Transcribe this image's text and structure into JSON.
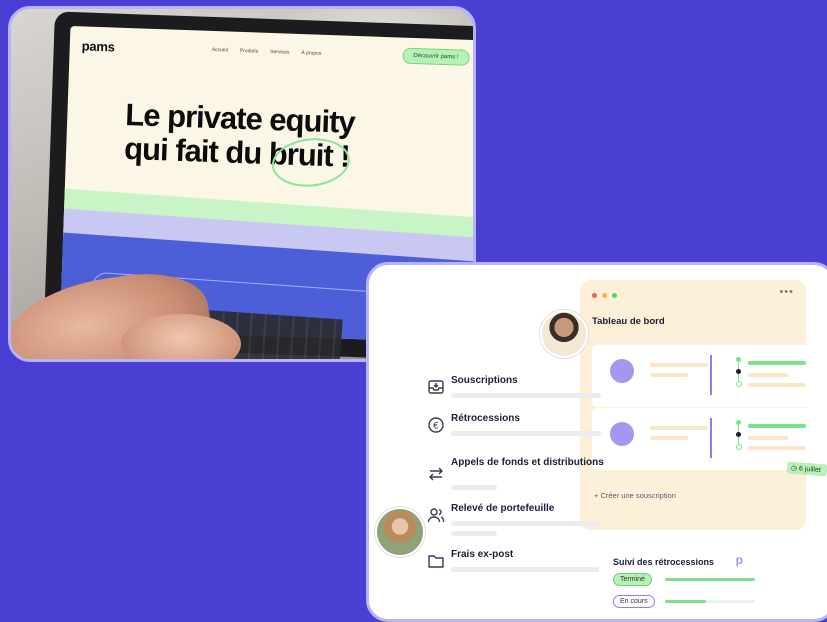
{
  "website": {
    "logo": "pams",
    "nav_links": [
      "Accueil",
      "Produits",
      "Services",
      "À propos"
    ],
    "cta": "Découvrir pams !",
    "hero_line1": "Le private equity",
    "hero_line2": "qui fait du bruit !"
  },
  "dashboard": {
    "window_dots": [
      "#f25c54",
      "#f7b731",
      "#4cd964"
    ],
    "more_icon": "•••",
    "panel_title": "Tableau de bord",
    "create_link": "+ Créer une souscription",
    "date_chip": "◷ 6 juillet",
    "menu": [
      {
        "label": "Souscriptions",
        "icon": "inbox-icon"
      },
      {
        "label": "Rétrocessions",
        "icon": "euro-icon"
      },
      {
        "label": "Appels de fonds et distributions",
        "icon": "swap-arrows-icon"
      },
      {
        "label": "Relevé de portefeuille",
        "icon": "users-icon"
      },
      {
        "label": "Frais ex-post",
        "icon": "folder-icon"
      }
    ],
    "retro": {
      "title": "Suivi des rétrocessions",
      "logo": "p",
      "status_done": "Terminé",
      "status_in_progress": "En cours",
      "progress_done": 1.0,
      "progress_in_progress": 0.45
    },
    "colors": {
      "accent_purple": "#a596f0",
      "accent_green": "#7de08a",
      "background": "#4a3fd3"
    }
  }
}
